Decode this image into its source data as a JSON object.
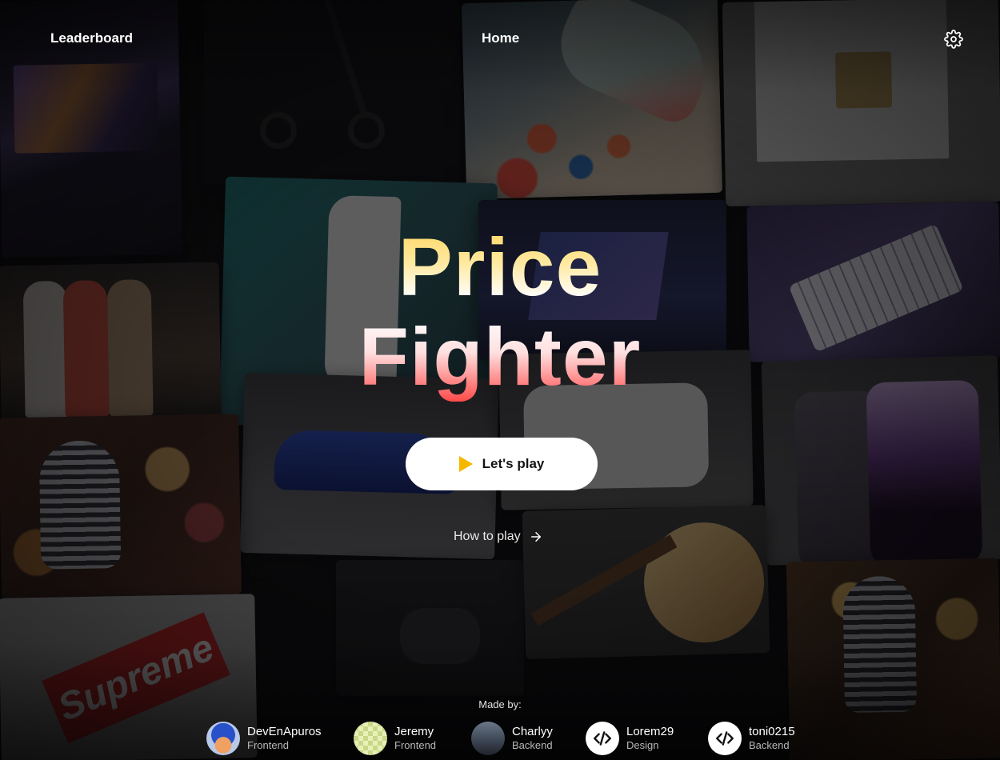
{
  "nav": {
    "leaderboard_label": "Leaderboard",
    "home_label": "Home",
    "settings_icon": "gear-icon"
  },
  "hero": {
    "title_line1": "Price",
    "title_line2": "Fighter",
    "play_label": "Let's play",
    "play_icon": "play-icon",
    "how_to_play_label": "How to play",
    "how_to_play_icon": "arrow-right-icon"
  },
  "colors": {
    "accent_yellow": "#f5b800",
    "title_gradient_top": "#ffd35a",
    "title_gradient_bottom": "#ff4a4a"
  },
  "footer": {
    "made_by_label": "Made by:",
    "team": [
      {
        "name": "DevEnApuros",
        "role": "Frontend",
        "avatar": "cartoon-avatar"
      },
      {
        "name": "Jeremy",
        "role": "Frontend",
        "avatar": "pixel-avatar"
      },
      {
        "name": "Charlyy",
        "role": "Backend",
        "avatar": "photo-avatar"
      },
      {
        "name": "Lorem29",
        "role": "Design",
        "avatar": "code-icon"
      },
      {
        "name": "toni0215",
        "role": "Backend",
        "avatar": "code-icon"
      }
    ]
  },
  "background": {
    "collage_images": [
      "laptop",
      "electric-scooter",
      "sneaker",
      "shelf",
      "playstation-5",
      "macbook",
      "keyboard",
      "mannequins",
      "car",
      "xbox",
      "iphone",
      "microphone",
      "guitar",
      "microphone",
      "supreme-hoodie",
      "controller"
    ]
  }
}
